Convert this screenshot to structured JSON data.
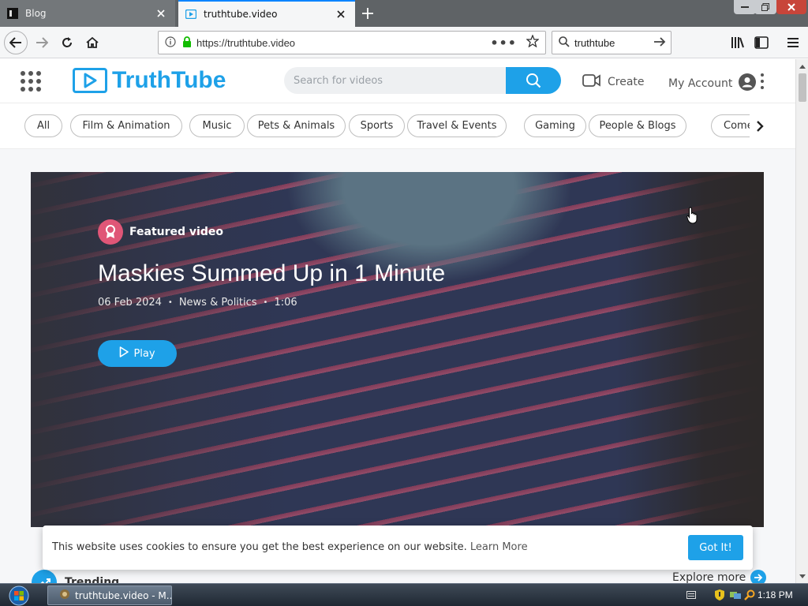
{
  "browser": {
    "tabs": [
      {
        "label": "Blog",
        "active": false
      },
      {
        "label": "truthtube.video",
        "active": true
      }
    ],
    "url": "https://truthtube.video",
    "search_value": "truthtube"
  },
  "header": {
    "logo_text": "TruthTube",
    "search_placeholder": "Search for videos",
    "create_label": "Create",
    "account_label": "My Account"
  },
  "categories": [
    "All",
    "Film & Animation",
    "Music",
    "Pets & Animals",
    "Sports",
    "Travel & Events",
    "Gaming",
    "People & Blogs",
    "Come"
  ],
  "hero": {
    "badge_label": "Featured video",
    "title": "Maskies Summed Up in 1 Minute",
    "date": "06 Feb 2024",
    "category": "News & Politics",
    "duration": "1:06",
    "play_label": "Play"
  },
  "sections": {
    "trending_label": "Trending",
    "explore_label": "Explore more"
  },
  "cookie": {
    "text": "This website uses cookies to ensure you get the best experience on our website.",
    "link": "Learn More",
    "button": "Got It!"
  },
  "taskbar": {
    "task_label": "truthtube.video - M...",
    "clock": "1:18 PM"
  },
  "colors": {
    "accent": "#1ea1e8",
    "badge": "#e05677"
  }
}
